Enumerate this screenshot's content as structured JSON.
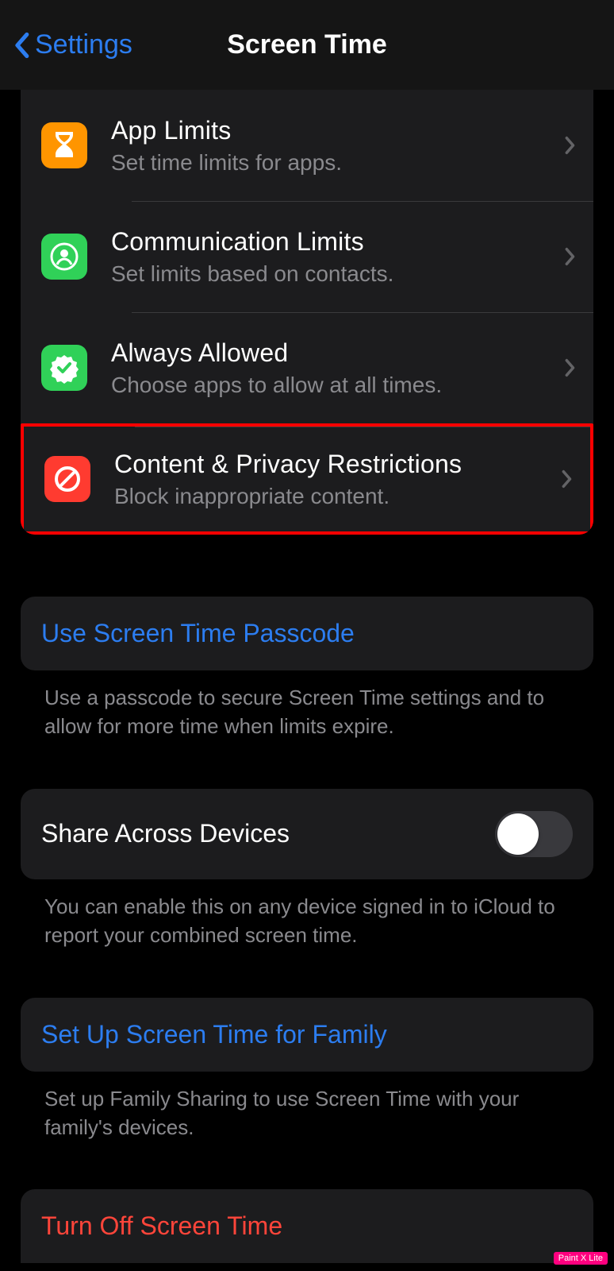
{
  "nav": {
    "back_label": "Settings",
    "title": "Screen Time"
  },
  "rows": {
    "app_limits": {
      "title": "App Limits",
      "sub": "Set time limits for apps."
    },
    "comm_limits": {
      "title": "Communication Limits",
      "sub": "Set limits based on contacts."
    },
    "always_allowed": {
      "title": "Always Allowed",
      "sub": "Choose apps to allow at all times."
    },
    "content_privacy": {
      "title": "Content & Privacy Restrictions",
      "sub": "Block inappropriate content."
    }
  },
  "passcode": {
    "label": "Use Screen Time Passcode",
    "footer": "Use a passcode to secure Screen Time settings and to allow for more time when limits expire."
  },
  "share": {
    "label": "Share Across Devices",
    "footer": "You can enable this on any device signed in to iCloud to report your combined screen time."
  },
  "family": {
    "label": "Set Up Screen Time for Family",
    "footer": "Set up Family Sharing to use Screen Time with your family's devices."
  },
  "turn_off": {
    "label": "Turn Off Screen Time"
  },
  "watermark": "Paint X Lite",
  "colors": {
    "orange": "#ff9500",
    "green": "#30d158",
    "red": "#ff3b30",
    "blue": "#2c7df0"
  }
}
